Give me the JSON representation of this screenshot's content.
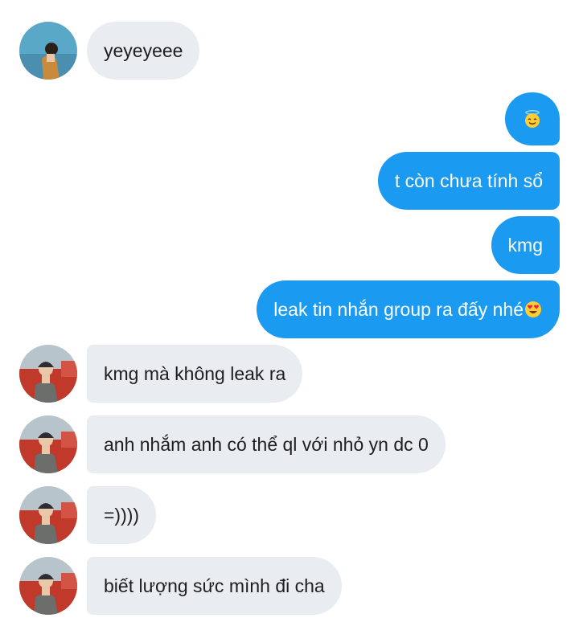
{
  "messages": [
    {
      "side": "in",
      "avatar": "avatar-user-a",
      "text": "yeyeyeee"
    },
    {
      "side": "out",
      "text": "",
      "emoji": "smiling-face-with-halo"
    },
    {
      "side": "out",
      "text": "t còn chưa tính sổ"
    },
    {
      "side": "out",
      "text": "kmg"
    },
    {
      "side": "out",
      "text": "leak tin nhắn group ra đấy nhé",
      "emoji": "smiling-face-with-heart-eyes"
    },
    {
      "side": "in",
      "avatar": "avatar-user-b",
      "text": "kmg mà không leak ra"
    },
    {
      "side": "in",
      "avatar": "avatar-user-b",
      "text": "anh nhắm anh có thể ql với nhỏ yn dc 0"
    },
    {
      "side": "in",
      "avatar": "avatar-user-b",
      "text": "=))))"
    },
    {
      "side": "in",
      "avatar": "avatar-user-b",
      "text": "biết lượng sức mình đi cha"
    }
  ],
  "colors": {
    "incoming_bubble": "#e9ecf0",
    "outgoing_bubble": "#1a9af0",
    "incoming_text": "#1c1e21",
    "outgoing_text": "#ffffff"
  }
}
